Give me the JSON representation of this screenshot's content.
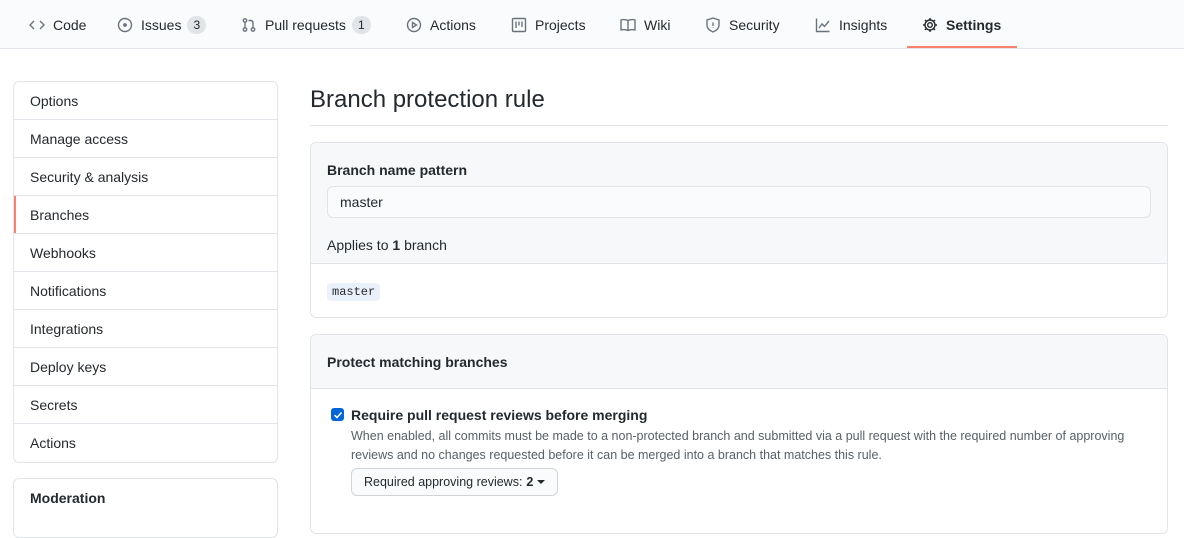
{
  "nav": {
    "tabs": [
      {
        "label": "Code",
        "icon": "code-icon"
      },
      {
        "label": "Issues",
        "icon": "issue-icon",
        "count": "3"
      },
      {
        "label": "Pull requests",
        "icon": "pull-request-icon",
        "count": "1"
      },
      {
        "label": "Actions",
        "icon": "play-icon"
      },
      {
        "label": "Projects",
        "icon": "project-icon"
      },
      {
        "label": "Wiki",
        "icon": "book-icon"
      },
      {
        "label": "Security",
        "icon": "shield-icon"
      },
      {
        "label": "Insights",
        "icon": "graph-icon"
      },
      {
        "label": "Settings",
        "icon": "gear-icon"
      }
    ],
    "active_tab": "Settings",
    "accent_color": "#f9826c"
  },
  "sidebar": {
    "items": [
      {
        "label": "Options"
      },
      {
        "label": "Manage access"
      },
      {
        "label": "Security & analysis"
      },
      {
        "label": "Branches"
      },
      {
        "label": "Webhooks"
      },
      {
        "label": "Notifications"
      },
      {
        "label": "Integrations"
      },
      {
        "label": "Deploy keys"
      },
      {
        "label": "Secrets"
      },
      {
        "label": "Actions"
      }
    ],
    "selected": "Branches",
    "moderation_heading": "Moderation"
  },
  "main": {
    "title": "Branch protection rule",
    "pattern": {
      "label": "Branch name pattern",
      "value": "master",
      "applies_prefix": "Applies to",
      "applies_count": "1",
      "applies_suffix": "branch",
      "matched_branch": "master"
    },
    "protect": {
      "heading": "Protect matching branches",
      "option_title": "Require pull request reviews before merging",
      "option_checked": true,
      "option_desc": "When enabled, all commits must be made to a non-protected branch and submitted via a pull request with the required number of approving reviews and no changes requested before it can be merged into a branch that matches this rule.",
      "reviews_label": "Required approving reviews:",
      "reviews_value": "2"
    }
  }
}
